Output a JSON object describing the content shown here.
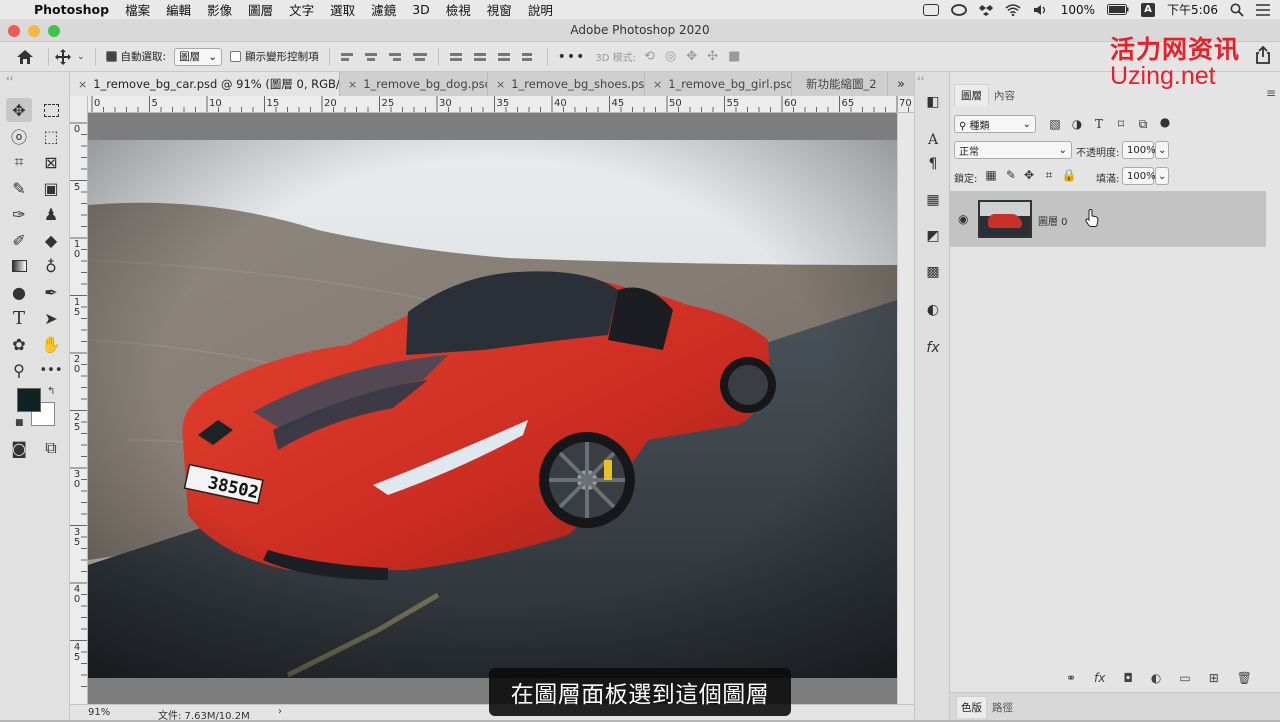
{
  "menubar": {
    "app": "Photoshop",
    "items": [
      "檔案",
      "編輯",
      "影像",
      "圖層",
      "文字",
      "選取",
      "濾鏡",
      "3D",
      "檢視",
      "視窗",
      "說明"
    ],
    "battery": "100%",
    "input_badge": "A",
    "clock": "下午5:06"
  },
  "window": {
    "title": "Adobe Photoshop 2020"
  },
  "options": {
    "auto_select_label": "自動選取:",
    "auto_select_value": "圖層",
    "transform_controls_label": "顯示變形控制項",
    "mode_3d_label": "3D 模式:",
    "more": "•••"
  },
  "tabs": [
    {
      "label": "1_remove_bg_car.psd @ 91% (圖層 0, RGB/8) *",
      "close": "×"
    },
    {
      "label": "1_remove_bg_dog.psd",
      "close": "×"
    },
    {
      "label": "1_remove_bg_shoes.psd",
      "close": "×"
    },
    {
      "label": "1_remove_bg_girl.psd",
      "close": "×"
    },
    {
      "label": "新功能縮圖_2",
      "close": ""
    }
  ],
  "tabs_overflow": "»",
  "ruler_top": [
    "0",
    "5",
    "10",
    "15",
    "20",
    "25",
    "30",
    "35",
    "40",
    "45",
    "50",
    "55",
    "60",
    "65",
    "70"
  ],
  "ruler_left": [
    "0",
    "5",
    "1\n0",
    "1\n5",
    "2\n0",
    "2\n5",
    "3\n0",
    "3\n5",
    "4\n0",
    "4\n5"
  ],
  "photo": {
    "plate": "38502"
  },
  "status": {
    "zoom": "91%",
    "doc": "文件: 7.63M/10.2M",
    "arrow": "›"
  },
  "subtitle": "在圖層面板選到這個圖層",
  "layers_panel": {
    "tab_layers": "圖層",
    "tab_properties": "內容",
    "filter_kind": "種類",
    "blend_mode": "正常",
    "opacity_label": "不透明度:",
    "opacity_value": "100%",
    "lock_label": "鎖定:",
    "fill_label": "填滿:",
    "fill_value": "100%",
    "layer_name": "圖層 0",
    "bottom_tab_color": "色版",
    "bottom_tab_paths": "路徑",
    "filter_icons": [
      "T"
    ]
  },
  "watermark": {
    "line1": "活力网资讯",
    "line2": "Uzing.net"
  },
  "icons": {
    "apple": "",
    "menu_icons": [
      "screen-record-icon",
      "creative-cloud-icon",
      "dropbox-icon",
      "wifi-icon",
      "volume-icon",
      "battery-icon",
      "search-icon",
      "list-icon"
    ],
    "tools": [
      "move-icon",
      "marquee-icon",
      "lasso-icon",
      "object-select-icon",
      "crop-icon",
      "frame-icon",
      "eyedropper-icon",
      "patch-icon",
      "brush-icon",
      "stamp-icon",
      "history-brush-icon",
      "eraser-icon",
      "gradient-icon",
      "blur-icon",
      "dodge-icon",
      "pen-icon",
      "type-icon",
      "path-select-icon",
      "shape-icon",
      "hand-icon",
      "zoom-icon",
      "more-icon"
    ]
  },
  "colors": {
    "foreground": "#0f2324",
    "background": "#ffffff",
    "watermark": "#e5212a",
    "car": "#d33226"
  }
}
